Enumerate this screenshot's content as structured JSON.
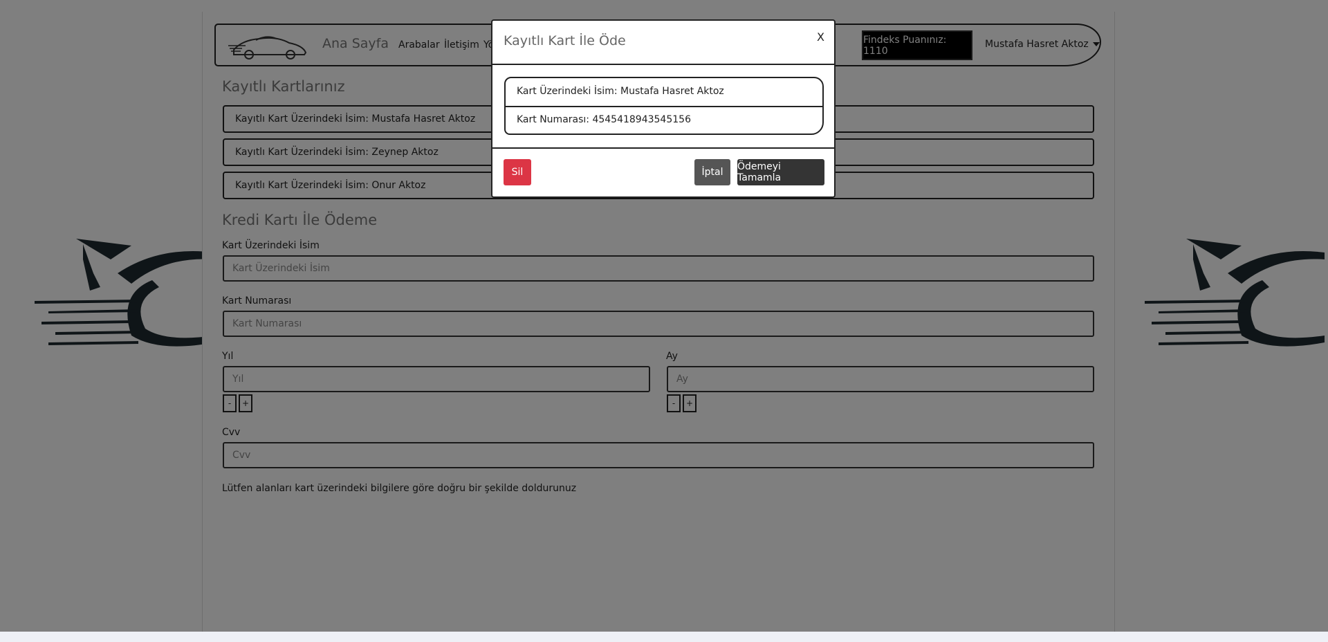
{
  "navbar": {
    "brand": "Ana Sayfa",
    "links": [
      "Arabalar",
      "İletişim",
      "Yö"
    ],
    "findeks": "Findeks Puanınız: 1110",
    "user": "Mustafa Hasret Aktoz"
  },
  "saved_cards": {
    "title": "Kayıtlı Kartlarınız",
    "items": [
      "Kayıtlı Kart Üzerindeki İsim: Mustafa Hasret Aktoz",
      "Kayıtlı Kart Üzerindeki İsim: Zeynep Aktoz",
      "Kayıtlı Kart Üzerindeki İsim: Onur Aktoz"
    ]
  },
  "payment_form": {
    "title": "Kredi Kartı İle Ödeme",
    "name_label": "Kart Üzerindeki İsim",
    "name_placeholder": "Kart Üzerindeki İsim",
    "number_label": "Kart Numarası",
    "number_placeholder": "Kart Numarası",
    "year_label": "Yıl",
    "year_placeholder": "Yıl",
    "month_label": "Ay",
    "month_placeholder": "Ay",
    "minus": "-",
    "plus": "+",
    "cvv_label": "Cvv",
    "cvv_placeholder": "Cvv",
    "help": "Lütfen alanları kart üzerindeki bilgilere göre doğru bir şekilde doldurunuz"
  },
  "modal": {
    "title": "Kayıtlı Kart İle Öde",
    "close": "X",
    "card_name": "Kart Üzerindeki İsim: Mustafa Hasret Aktoz",
    "card_number": "Kart Numarası: 4545418943545156",
    "delete": "Sil",
    "cancel": "İptal",
    "complete": "Ödemeyi Tamamla"
  },
  "colors": {
    "overlay": "#000000",
    "delete": "#dc3545",
    "cancel": "#555555",
    "complete": "#343434",
    "findeks_bg": "#000000"
  }
}
